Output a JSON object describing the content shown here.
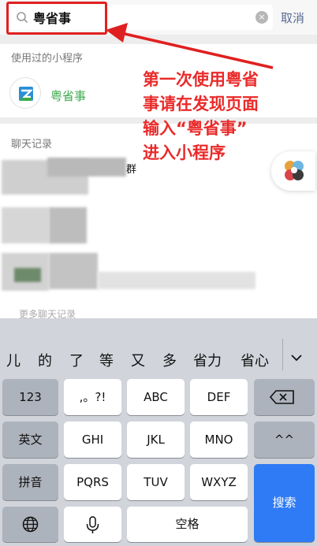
{
  "search": {
    "query": "粤省事",
    "cancel_label": "取消",
    "clear_icon": "×"
  },
  "sections": {
    "used_label": "使用过的小程序",
    "chat_label": "聊天记录"
  },
  "mini_program": {
    "name": "粤省事",
    "logo_icon": "yue-logo-icon"
  },
  "chat": {
    "visible_fragment": "群",
    "more_label": "更多聊天记录"
  },
  "annotation": {
    "lines": [
      "第一次使用粤省",
      "事请在发现页面",
      "输入“粤省事”",
      "进入小程序"
    ],
    "color": "#ea2a2a"
  },
  "keyboard": {
    "candidates": [
      "儿",
      "的",
      "了",
      "等",
      "又",
      "多",
      "省力",
      "省心"
    ],
    "rows": [
      [
        "123",
        ",。?!",
        "ABC",
        "DEF",
        "⌫"
      ],
      [
        "英文",
        "GHI",
        "JKL",
        "MNO",
        "^^"
      ],
      [
        "拼音",
        "PQRS",
        "TUV",
        "WXYZ",
        "搜索"
      ],
      [
        "globe",
        "mic",
        "空格"
      ]
    ],
    "labels": {
      "k123": "123",
      "punct": ",。?!",
      "abc": "ABC",
      "def": "DEF",
      "en": "英文",
      "ghi": "GHI",
      "jkl": "JKL",
      "mno": "MNO",
      "face": "^^",
      "pinyin": "拼音",
      "pqrs": "PQRS",
      "tuv": "TUV",
      "wxyz": "WXYZ",
      "search": "搜索",
      "space": "空格"
    },
    "accent": "#2f7bf5"
  }
}
